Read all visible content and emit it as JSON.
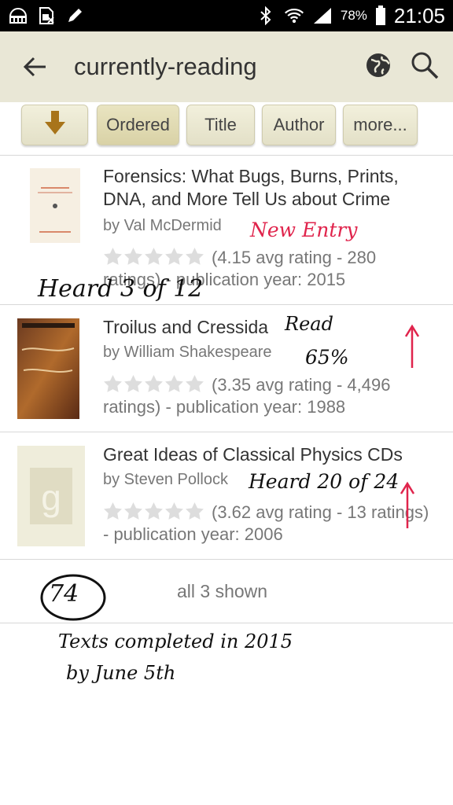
{
  "status_bar": {
    "battery": "78%",
    "time": "21:05",
    "icons": [
      "gallery-icon",
      "sim-off-icon",
      "pen-icon",
      "bluetooth-icon",
      "wifi-icon",
      "signal-icon",
      "battery-icon"
    ]
  },
  "action_bar": {
    "title": "currently-reading",
    "icons": [
      "back-arrow-icon",
      "globe-icon",
      "search-icon"
    ]
  },
  "sort_bar": {
    "buttons": [
      "Ordered",
      "Title",
      "Author",
      "more..."
    ],
    "download_icon": "down-arrow-icon",
    "active": "Ordered"
  },
  "books": [
    {
      "title": "Forensics: What Bugs, Burns, Prints, DNA, and More Tell Us about Crime",
      "author": "by Val McDermid",
      "meta": "(4.15 avg rating - 280 ratings) - publication year: 2015"
    },
    {
      "title": "Troilus and Cressida",
      "author": "by William Shakespeare",
      "meta": "(3.35 avg rating - 4,496 ratings) - publication year: 1988"
    },
    {
      "title": "Great Ideas of Classical Physics CDs",
      "author": "by Steven Pollock",
      "meta": "(3.62 avg rating - 13 ratings) - publication year: 2006"
    }
  ],
  "footer": {
    "shown_text": "all 3 shown"
  },
  "handwriting": {
    "new_entry": "New Entry",
    "heard_3_of_12": "Heard 3 of 12",
    "read": "Read",
    "percent": "65%",
    "heard_20_of_24": "Heard 20 of 24",
    "circled_number": "74",
    "note_line1": "Texts completed in 2015",
    "note_line2": "by June 5th"
  },
  "colors": {
    "action_bar": "#e9e7d6",
    "button": "#e3e0c7",
    "ink_red": "#e0244c"
  }
}
